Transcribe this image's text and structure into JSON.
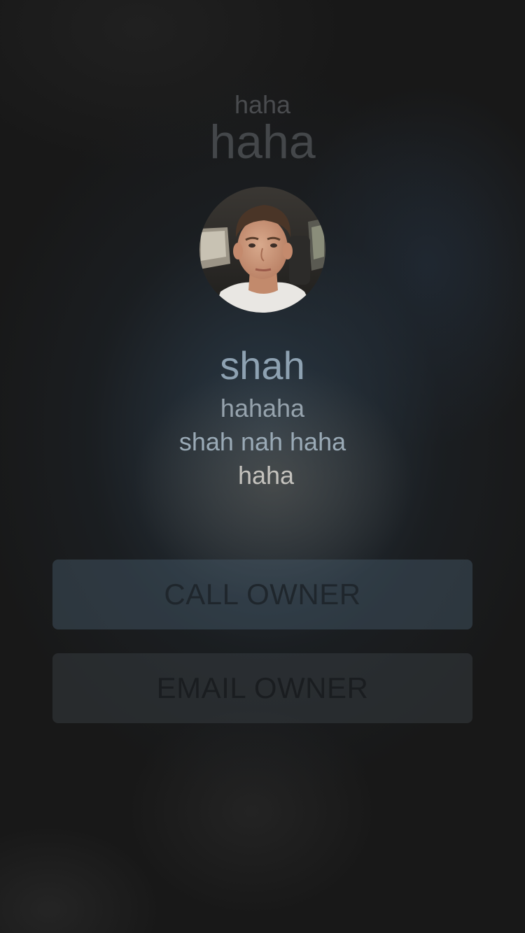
{
  "header": {
    "subtitle": "haha",
    "title": "haha"
  },
  "profile": {
    "name": "shah",
    "details": [
      "hahaha",
      "shah nah haha",
      "haha"
    ]
  },
  "actions": {
    "call_label": "CALL OWNER",
    "email_label": "EMAIL OWNER"
  },
  "colors": {
    "background": "#181818",
    "name_text": "#8ea2b2",
    "call_button": "#465a6a",
    "email_button": "#3c4248"
  },
  "icons": {
    "avatar": "profile-photo"
  }
}
